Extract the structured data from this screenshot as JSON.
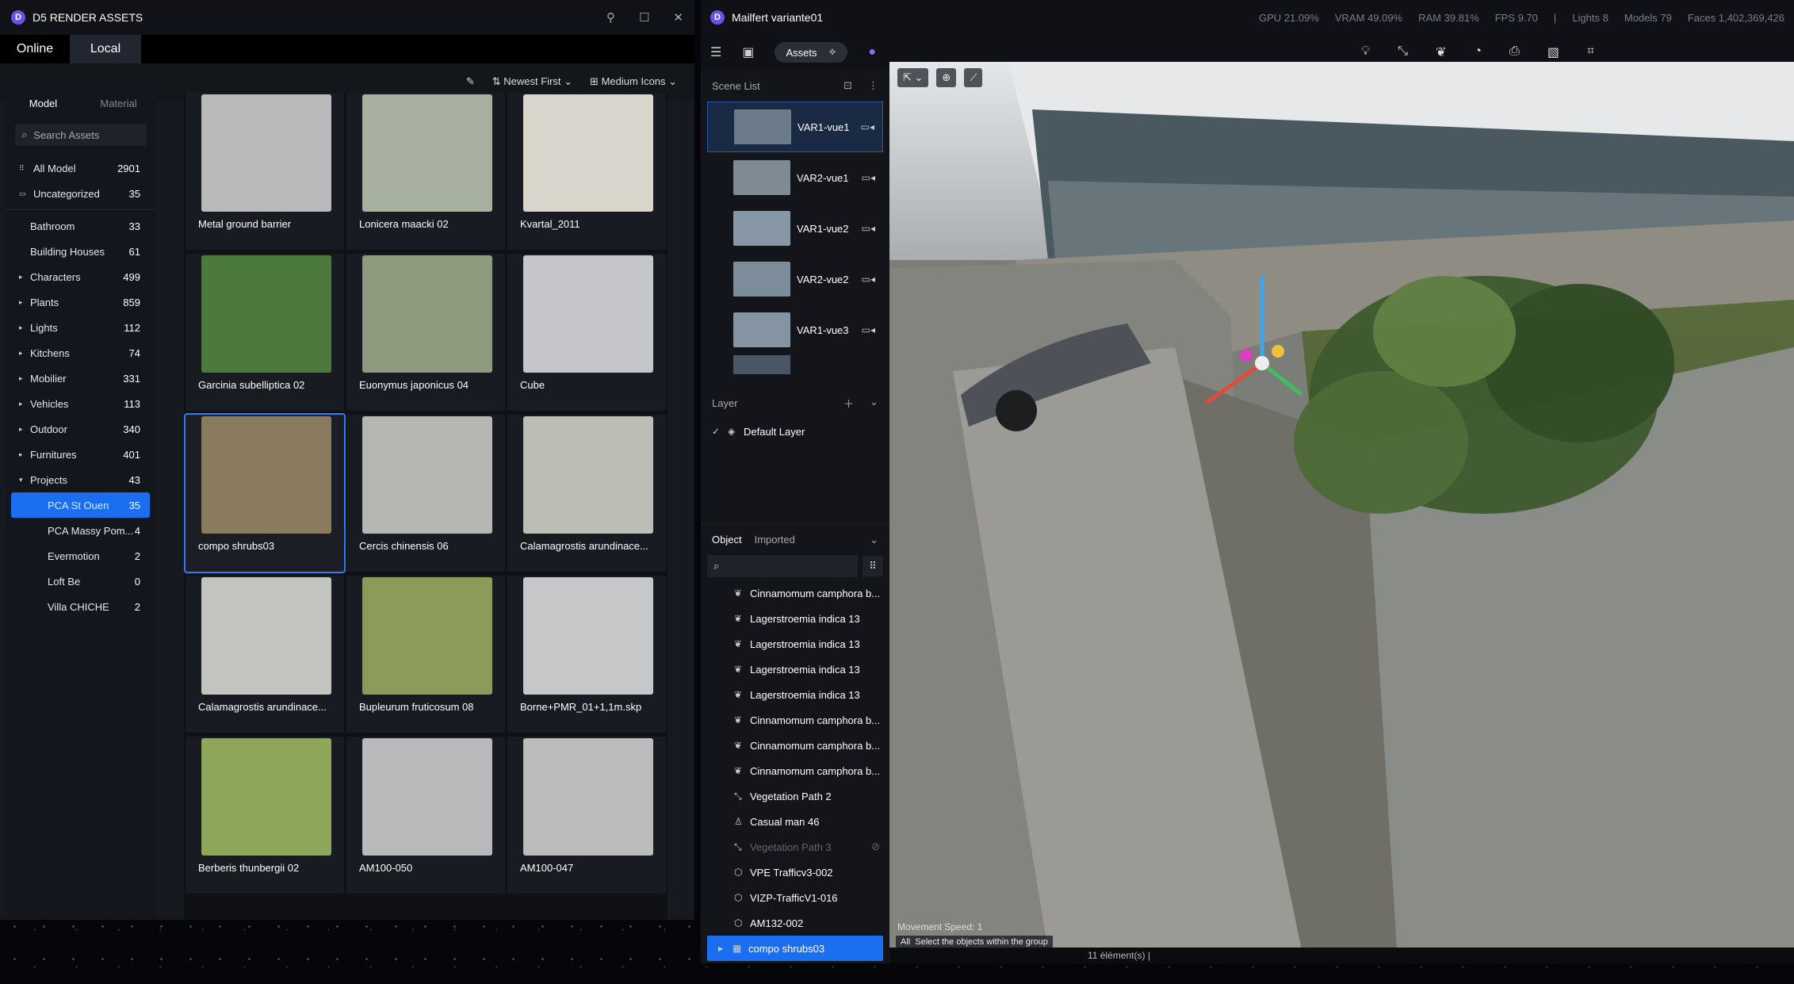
{
  "assets": {
    "title": "D5 RENDER ASSETS",
    "tabs": [
      "Online",
      "Local"
    ],
    "sort": "Newest First",
    "view": "Medium Icons",
    "model_tab": "Model",
    "material_tab": "Material",
    "search_placeholder": "Search Assets",
    "top_cats": [
      {
        "label": "All Model",
        "count": "2901"
      },
      {
        "label": "Uncategorized",
        "count": "35"
      }
    ],
    "cats": [
      {
        "label": "Bathroom",
        "count": "33",
        "arrow": ""
      },
      {
        "label": "Building Houses",
        "count": "61",
        "arrow": ""
      },
      {
        "label": "Characters",
        "count": "499",
        "arrow": "▸"
      },
      {
        "label": "Plants",
        "count": "859",
        "arrow": "▸"
      },
      {
        "label": "Lights",
        "count": "112",
        "arrow": "▸"
      },
      {
        "label": "Kitchens",
        "count": "74",
        "arrow": "▸"
      },
      {
        "label": "Mobilier",
        "count": "331",
        "arrow": "▸"
      },
      {
        "label": "Vehicles",
        "count": "113",
        "arrow": "▸"
      },
      {
        "label": "Outdoor",
        "count": "340",
        "arrow": "▸"
      },
      {
        "label": "Furnitures",
        "count": "401",
        "arrow": "▸"
      },
      {
        "label": "Projects",
        "count": "43",
        "arrow": "▾"
      },
      {
        "label": "PCA St Ouen",
        "count": "35",
        "arrow": ""
      },
      {
        "label": "PCA Massy Pom...",
        "count": "4",
        "arrow": ""
      },
      {
        "label": "Evermotion",
        "count": "2",
        "arrow": ""
      },
      {
        "label": "Loft Be",
        "count": "0",
        "arrow": ""
      },
      {
        "label": "Villa CHICHE",
        "count": "2",
        "arrow": ""
      }
    ],
    "items": [
      {
        "label": "Metal ground barrier",
        "color": "#b9b9bb"
      },
      {
        "label": "Lonicera maacki 02",
        "color": "#a7b09f"
      },
      {
        "label": "Kvartal_2011",
        "color": "#d9d4cc"
      },
      {
        "label": "Garcinia subelliptica 02",
        "color": "#4c7a3c"
      },
      {
        "label": "Euonymus japonicus 04",
        "color": "#8e9a7e"
      },
      {
        "label": "Cube",
        "color": "#c4c6ca"
      },
      {
        "label": "compo shrubs03",
        "color": "#8a7a5e"
      },
      {
        "label": "Cercis chinensis 06",
        "color": "#b5b8b2"
      },
      {
        "label": "Calamagrostis arundinace...",
        "color": "#bcbdb5"
      },
      {
        "label": "Calamagrostis arundinace...",
        "color": "#c2c4bd"
      },
      {
        "label": "Bupleurum fruticosum 08",
        "color": "#8c9a5a"
      },
      {
        "label": "Borne+PMR_01+1,1m.skp",
        "color": "#c6c7c9"
      },
      {
        "label": "Berberis thunbergii 02",
        "color": "#8ea65a"
      },
      {
        "label": "AM100-050",
        "color": "#b8b9bb"
      },
      {
        "label": "AM100-047",
        "color": "#bcbcbc"
      }
    ]
  },
  "d5": {
    "title": "Mailfert variante01",
    "stats": [
      "GPU 21.09%",
      "VRAM 49.09%",
      "RAM 39.81%",
      "FPS 9.70",
      "|",
      "Lights 8",
      "Models 79",
      "Faces 1,402,369,426"
    ],
    "assets_btn": "Assets",
    "scene_list": "Scene List",
    "scenes": [
      {
        "label": "VAR1-vue1",
        "color": "#6c7b8a"
      },
      {
        "label": "VAR2-vue1",
        "color": "#7e8a94"
      },
      {
        "label": "VAR1-vue2",
        "color": "#8797a6"
      },
      {
        "label": "VAR2-vue2",
        "color": "#7d8c9a"
      },
      {
        "label": "VAR1-vue3",
        "color": "#8494a2"
      }
    ],
    "layer_head": "Layer",
    "layer": "Default Layer",
    "obj_tabs": [
      "Object",
      "Imported"
    ],
    "objects": [
      {
        "label": "Cinnamomum camphora b...",
        "icon": "leaf-icon",
        "glyph": "❦"
      },
      {
        "label": "Lagerstroemia indica 13",
        "icon": "leaf-icon",
        "glyph": "❦"
      },
      {
        "label": "Lagerstroemia indica 13",
        "icon": "leaf-icon",
        "glyph": "❦"
      },
      {
        "label": "Lagerstroemia indica 13",
        "icon": "leaf-icon",
        "glyph": "❦"
      },
      {
        "label": "Lagerstroemia indica 13",
        "icon": "leaf-icon",
        "glyph": "❦"
      },
      {
        "label": "Cinnamomum camphora b...",
        "icon": "leaf-icon",
        "glyph": "❦"
      },
      {
        "label": "Cinnamomum camphora b...",
        "icon": "leaf-icon",
        "glyph": "❦"
      },
      {
        "label": "Cinnamomum camphora b...",
        "icon": "leaf-icon",
        "glyph": "❦"
      },
      {
        "label": "Vegetation Path 2",
        "icon": "path-icon",
        "glyph": "⤡"
      },
      {
        "label": "Casual man 46",
        "icon": "person-icon",
        "glyph": "♙"
      },
      {
        "label": "Vegetation Path 3",
        "icon": "path-icon",
        "glyph": "⤡"
      },
      {
        "label": "VPE Trafficv3-002",
        "icon": "model-icon",
        "glyph": "⬡"
      },
      {
        "label": "VIZP-TrafficV1-016",
        "icon": "model-icon",
        "glyph": "⬡"
      },
      {
        "label": "AM132-002",
        "icon": "model-icon",
        "glyph": "⬡"
      },
      {
        "label": "compo shrubs03",
        "icon": "group-icon",
        "glyph": "▦"
      }
    ],
    "movement": "Movement Speed: 1",
    "hint_all": "All",
    "hint": "Select the objects within the group",
    "footer": "11 élément(s)"
  }
}
